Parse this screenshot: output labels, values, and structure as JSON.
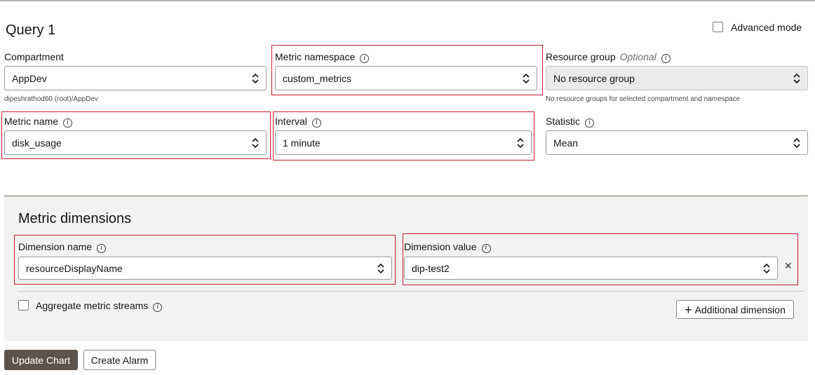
{
  "query": {
    "title": "Query 1",
    "advanced_mode_label": "Advanced mode"
  },
  "compartment": {
    "label": "Compartment",
    "value": "AppDev",
    "hint": "dipeshrathod60 (root)/AppDev"
  },
  "metric_namespace": {
    "label": "Metric namespace",
    "value": "custom_metrics"
  },
  "resource_group": {
    "label": "Resource group",
    "optional": "Optional",
    "value": "No resource group",
    "hint": "No resource groups for selected compartment and namespace"
  },
  "metric_name": {
    "label": "Metric name",
    "value": "disk_usage"
  },
  "interval": {
    "label": "Interval",
    "value": "1 minute"
  },
  "statistic": {
    "label": "Statistic",
    "value": "Mean"
  },
  "dimensions": {
    "title": "Metric dimensions",
    "name_label": "Dimension name",
    "name_value": "resourceDisplayName",
    "value_label": "Dimension value",
    "value_value": "dip-test2",
    "remove_glyph": "✕",
    "aggregate_label": "Aggregate metric streams",
    "add_button": "Additional dimension",
    "add_glyph": "+"
  },
  "actions": {
    "update_chart": "Update Chart",
    "create_alarm": "Create Alarm"
  },
  "icons": {
    "info": "info-icon",
    "select": "chevron-up-down-icon",
    "remove": "close-icon",
    "add": "plus-icon"
  },
  "colors": {
    "highlight": "#c71e2b",
    "primary_button": "#5c534c",
    "panel": "#f4f2f0"
  }
}
